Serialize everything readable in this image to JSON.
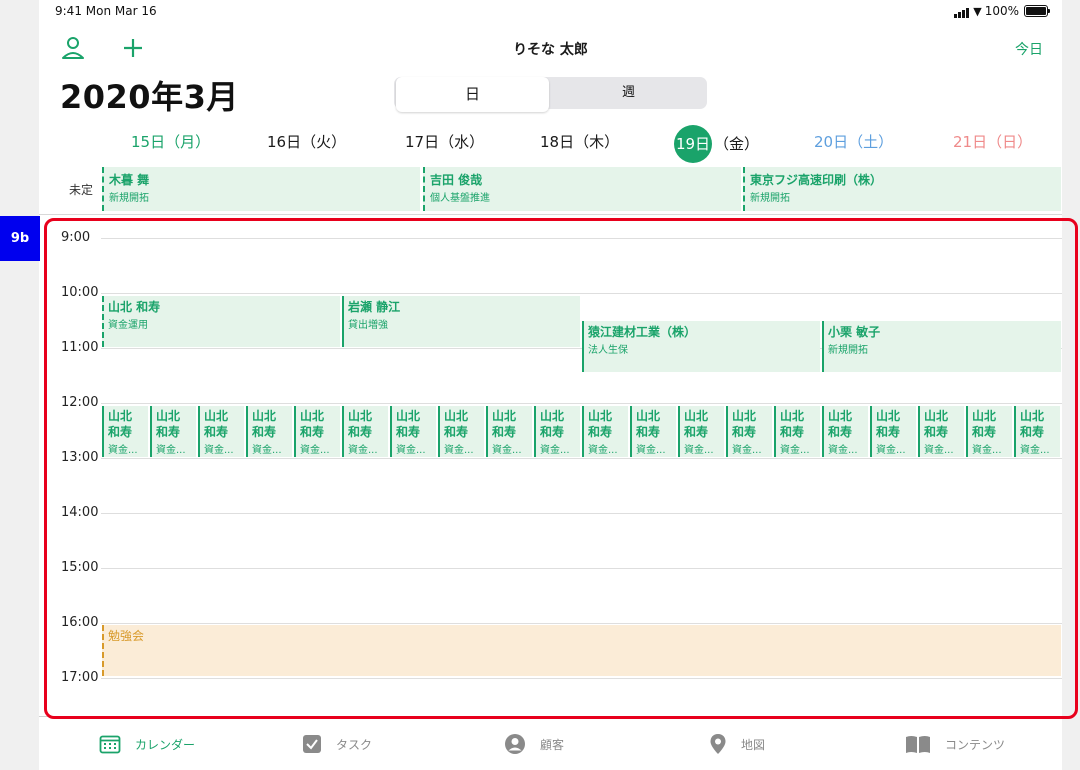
{
  "status": {
    "time": "9:41  Mon Mar 16",
    "battery": "100%"
  },
  "nav": {
    "title": "りそな 太郎",
    "today": "今日"
  },
  "month_title": "2020年3月",
  "segment": {
    "day": "日",
    "week": "週"
  },
  "days": [
    {
      "label": "15日（月）",
      "kind": "mon"
    },
    {
      "label": "16日（火）",
      "kind": "normal"
    },
    {
      "label": "17日（水）",
      "kind": "normal"
    },
    {
      "label": "18日（木）",
      "kind": "normal"
    },
    {
      "date": "19日",
      "dow": "（金）",
      "kind": "selected"
    },
    {
      "label": "20日（土）",
      "kind": "sat"
    },
    {
      "label": "21日（日）",
      "kind": "sun"
    }
  ],
  "allday": {
    "label": "未定",
    "events": [
      {
        "title": "木暮 舞",
        "sub": "新規開拓"
      },
      {
        "title": "吉田 俊哉",
        "sub": "個人基盤推進"
      },
      {
        "title": "東京フジ高速印刷（株）",
        "sub": "新規開拓"
      }
    ]
  },
  "hours": [
    "9:00",
    "10:00",
    "11:00",
    "12:00",
    "13:00",
    "14:00",
    "15:00",
    "16:00",
    "17:00"
  ],
  "events": {
    "yamakita": {
      "title": "山北 和寿",
      "sub": "資金運用"
    },
    "iwase": {
      "title": "岩瀬 静江",
      "sub": "貸出増強"
    },
    "saruee": {
      "title": "猿江建材工業（株）",
      "sub": "法人生保"
    },
    "oguri": {
      "title": "小栗 敏子",
      "sub": "新規開拓"
    },
    "small": {
      "title": "山北 和寿",
      "sub": "資金..."
    },
    "study": {
      "title": "勉強会"
    }
  },
  "tabs": [
    {
      "label": "カレンダー",
      "icon": "calendar-icon",
      "active": true
    },
    {
      "label": "タスク",
      "icon": "checkbox-icon",
      "active": false
    },
    {
      "label": "顧客",
      "icon": "person-circle-icon",
      "active": false
    },
    {
      "label": "地図",
      "icon": "map-pin-icon",
      "active": false
    },
    {
      "label": "コンテンツ",
      "icon": "book-icon",
      "active": false
    }
  ],
  "annotation": {
    "label": "9b"
  },
  "colors": {
    "accent": "#1aa36a",
    "event_bg": "#e5f4ea",
    "study": "#d89a2b",
    "study_bg": "#fbecd7",
    "saturday": "#5e9fde",
    "sunday": "#ef8a8a",
    "highlight": "#e8001c",
    "badge": "#0000ee"
  }
}
